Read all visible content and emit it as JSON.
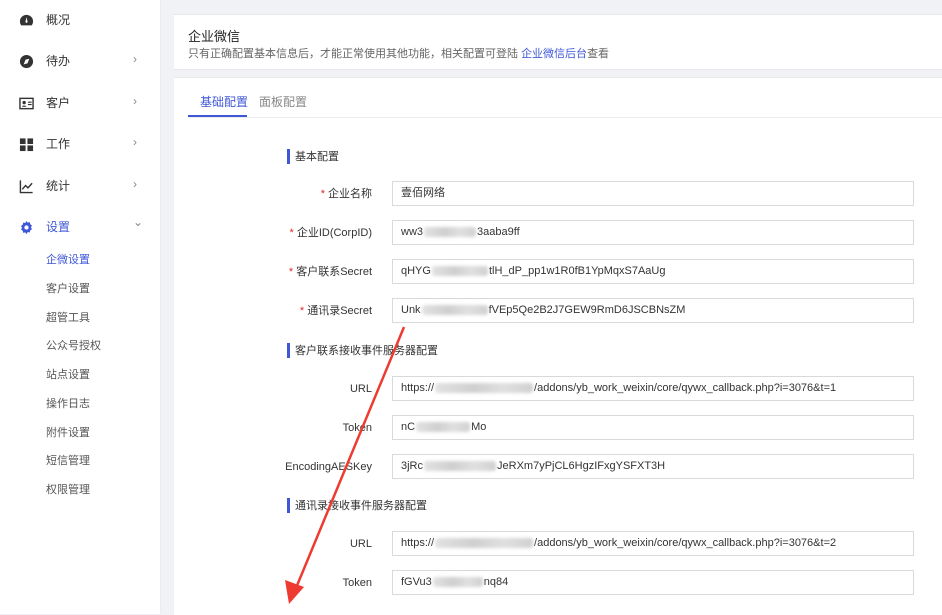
{
  "sidebar": {
    "items": [
      {
        "label": "概况",
        "icon": "dashboard-icon",
        "has_chevron": false
      },
      {
        "label": "待办",
        "icon": "compass-icon",
        "has_chevron": true
      },
      {
        "label": "客户",
        "icon": "contact-card-icon",
        "has_chevron": true
      },
      {
        "label": "工作",
        "icon": "grid-icon",
        "has_chevron": true
      },
      {
        "label": "统计",
        "icon": "trend-chart-icon",
        "has_chevron": true
      },
      {
        "label": "设置",
        "icon": "gear-icon",
        "has_chevron": true,
        "expanded": true
      }
    ],
    "chevron_right": "›",
    "chevron_down": "⌄",
    "sub_items": [
      "企微设置",
      "客户设置",
      "超管工具",
      "公众号授权",
      "站点设置",
      "操作日志",
      "附件设置",
      "短信管理",
      "权限管理"
    ],
    "active_sub": "企微设置"
  },
  "header": {
    "title": "企业微信",
    "desc_prefix": "只有正确配置基本信息后，才能正常使用其他功能，相关配置可登陆 ",
    "desc_link": "企业微信后台",
    "desc_suffix": "查看"
  },
  "tabs": [
    {
      "label": "基础配置",
      "active": true
    },
    {
      "label": "面板配置",
      "active": false
    }
  ],
  "sections": {
    "basic": "基本配置",
    "customer_callback": "客户联系接收事件服务器配置",
    "contacts_callback": "通讯录接收事件服务器配置"
  },
  "fields": {
    "corp_name": {
      "label": "企业名称",
      "required": true,
      "value": "壹佰网络"
    },
    "corp_id": {
      "label": "企业ID(CorpID)",
      "required": true,
      "value_start": "ww3",
      "value_end": "3aaba9ff"
    },
    "customer_secret": {
      "label": "客户联系Secret",
      "required": true,
      "value_start": "qHYG",
      "value_end": "tlH_dP_pp1w1R0fB1YpMqxS7AaUg"
    },
    "contacts_secret": {
      "label": "通讯录Secret",
      "required": true,
      "value_start": "Unk",
      "value_end": "fVEp5Qe2B2J7GEW9RmD6JSCBNsZM"
    },
    "cust_url": {
      "label": "URL",
      "value_start": "https://",
      "value_end": "/addons/yb_work_weixin/core/qywx_callback.php?i=3076&t=1"
    },
    "cust_token": {
      "label": "Token",
      "value_start": "nC",
      "value_end": "Mo"
    },
    "cust_aes": {
      "label": "EncodingAESKey",
      "value_start": "3jRc",
      "value_end": "JeRXm7yPjCL6HgzIFxgYSFXT3H"
    },
    "cont_url": {
      "label": "URL",
      "value_start": "https://",
      "value_end": "/addons/yb_work_weixin/core/qywx_callback.php?i=3076&t=2"
    },
    "cont_token": {
      "label": "Token",
      "value_start": "fGVu3",
      "value_end": "nq84"
    }
  },
  "colors": {
    "accent": "#3f57d7",
    "required": "#e02b2b",
    "annotation_arrow": "#ee3b32"
  }
}
